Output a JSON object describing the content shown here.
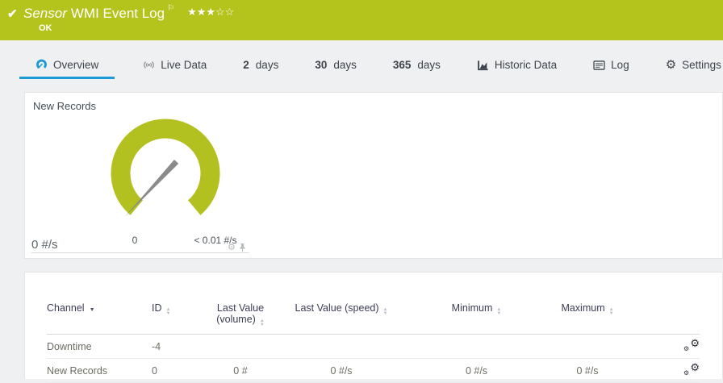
{
  "colors": {
    "brand_green": "#b5c31d",
    "accent_blue": "#1d9ad6",
    "gauge_green": "#b2c120"
  },
  "header": {
    "check_icon": "✔",
    "kicker": "Sensor",
    "title": "WMI Event Log",
    "flag_icon": "⚐",
    "stars_filled": "★★★",
    "stars_empty": "☆☆",
    "rating": "3 of 5",
    "status": "OK"
  },
  "tabs": {
    "overview": "Overview",
    "live_data": "Live Data",
    "days2_num": "2",
    "days2_label": "days",
    "days30_num": "30",
    "days30_label": "days",
    "days365_num": "365",
    "days365_label": "days",
    "historic": "Historic Data",
    "log": "Log",
    "settings": "Settings",
    "settings_icon": "⚙"
  },
  "gauge_panel": {
    "channel": "New Records",
    "min_label": "0",
    "max_label": "< 0.01 #/s",
    "current": "0 #/s",
    "gear_icon": "⚙",
    "chart": {
      "type": "gauge",
      "value": 0,
      "unit": "#/s",
      "scale_min_label": "0",
      "scale_max_label": "< 0.01 #/s",
      "needle_at": "minimum"
    }
  },
  "table": {
    "headers": {
      "channel": "Channel",
      "id": "ID",
      "lv_volume_1": "Last Value",
      "lv_volume_2": "(volume)",
      "lv_speed": "Last Value (speed)",
      "minimum": "Minimum",
      "maximum": "Maximum"
    },
    "rows": [
      {
        "channel": "Downtime",
        "id": "-4",
        "lv_volume": "",
        "lv_speed": "",
        "minimum": "",
        "maximum": ""
      },
      {
        "channel": "New Records",
        "id": "0",
        "lv_volume": "0 #",
        "lv_speed": "0 #/s",
        "minimum": "0 #/s",
        "maximum": "0 #/s"
      }
    ],
    "row_gear_icon": "⚙"
  }
}
